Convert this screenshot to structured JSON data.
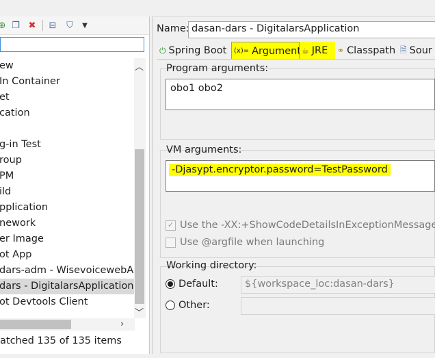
{
  "left": {
    "toolbar": {
      "icons": [
        "new-config-icon",
        "duplicate-icon",
        "delete-icon",
        "collapse-all-icon",
        "filter-icon",
        "view-menu-icon"
      ]
    },
    "filter": {
      "value": ""
    },
    "tree_items": [
      "ew",
      "In Container",
      "et",
      "cation",
      "",
      "g-in Test",
      "roup",
      "PM",
      "ild",
      "pplication",
      "nework",
      "er Image",
      "ot App",
      "dars-adm - WisevoicewebAp",
      "dars - DigitalarsApplication",
      "ot Devtools Client"
    ],
    "selected_index": 14,
    "status": "atched 135 of 135 items"
  },
  "right": {
    "name_label": "Name:",
    "name_value": "dasan-dars - DigitalarsApplication",
    "tabs": [
      {
        "label": "Spring Boot",
        "icon": "spring-boot-icon"
      },
      {
        "label": "Arguments",
        "icon": "arguments-icon",
        "active": true
      },
      {
        "label": "JRE",
        "icon": "jre-icon"
      },
      {
        "label": "Classpath",
        "icon": "classpath-icon"
      },
      {
        "label": "Sour",
        "icon": "source-icon"
      }
    ],
    "program_args": {
      "title": "Program arguments:",
      "value": "obo1 obo2"
    },
    "vm_args": {
      "title": "VM arguments:",
      "value": "-Djasypt.encryptor.password=TestPassword"
    },
    "options": {
      "show_code_details": {
        "label": "Use the -XX:+ShowCodeDetailsInExceptionMessages ar",
        "checked": true,
        "enabled": false
      },
      "argfile": {
        "label": "Use @argfile when launching",
        "checked": false,
        "enabled": false
      }
    },
    "working_dir": {
      "title": "Working directory:",
      "default_label": "Default:",
      "default_value": "${workspace_loc:dasan-dars}",
      "other_label": "Other:",
      "other_value": "",
      "selected": "default"
    }
  },
  "colors": {
    "highlight": "#ffff00",
    "selection": "#d9d9d9",
    "focus_border": "#3b8edc"
  }
}
